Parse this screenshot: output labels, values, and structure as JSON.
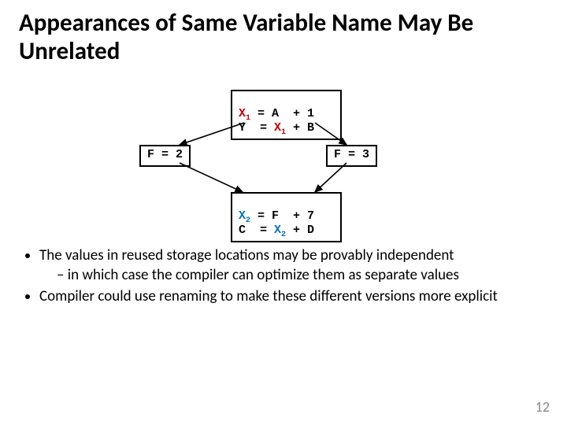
{
  "title": "Appearances of Same Variable Name May Be Unrelated",
  "diagram": {
    "top": {
      "l1_a": "X",
      "l1_sub": "1",
      "l1_b": " = A  + 1",
      "l2_a": "Y  = ",
      "l2_x": "X",
      "l2_sub": "1",
      "l2_b": " + B"
    },
    "left": "F = 2",
    "right": "F = 3",
    "bottom": {
      "l1_a": "X",
      "l1_sub": "2",
      "l1_b": " = F  + 7",
      "l2_a": "C  = ",
      "l2_x": "X",
      "l2_sub": "2",
      "l2_b": " + D"
    }
  },
  "bullets": {
    "b1": "The values in reused storage locations may be provably independent",
    "b1a": "in which case the compiler can optimize them as separate values",
    "b2": "Compiler could use renaming to make these different versions more explicit"
  },
  "page": "12"
}
